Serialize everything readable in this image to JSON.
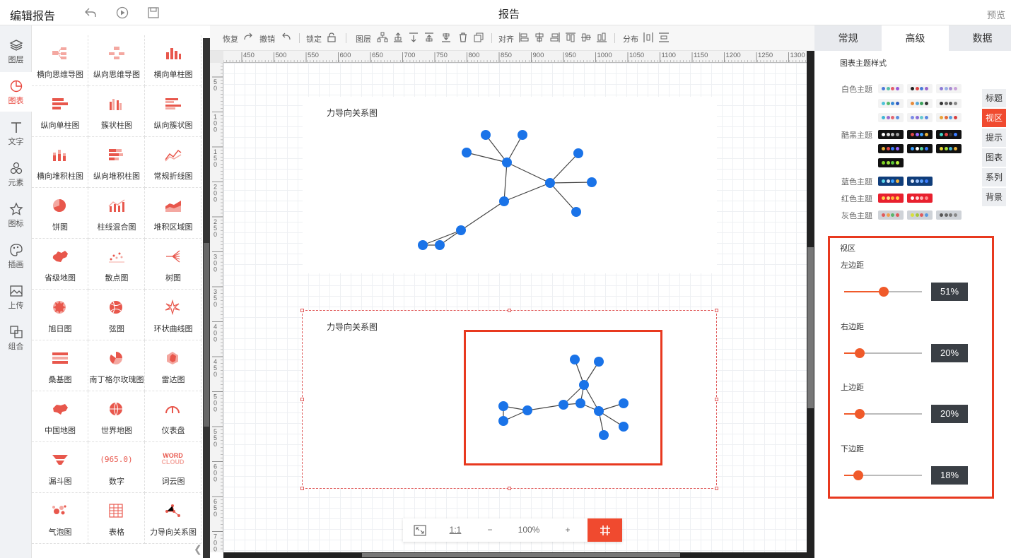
{
  "header": {
    "app_title": "编辑报告",
    "report_title": "报告",
    "preview": "预览"
  },
  "rail": [
    {
      "label": "图层",
      "icon": "layers-icon"
    },
    {
      "label": "图表",
      "icon": "chart-pie-icon",
      "active": true
    },
    {
      "label": "文字",
      "icon": "text-icon"
    },
    {
      "label": "元素",
      "icon": "elements-icon"
    },
    {
      "label": "图标",
      "icon": "star-icon"
    },
    {
      "label": "插画",
      "icon": "palette-icon"
    },
    {
      "label": "上传",
      "icon": "upload-image-icon"
    },
    {
      "label": "组合",
      "icon": "group-icon"
    }
  ],
  "palette": [
    "横向思维导图",
    "纵向思维导图",
    "横向单柱图",
    "纵向单柱图",
    "簇状柱图",
    "纵向簇状图",
    "横向堆积柱图",
    "纵向堆积柱图",
    "常规折线图",
    "饼图",
    "柱线混合图",
    "堆积区域图",
    "省级地图",
    "散点图",
    "树图",
    "旭日图",
    "弦图",
    "环状曲线图",
    "桑基图",
    "南丁格尔玫瑰图",
    "雷达图",
    "中国地图",
    "世界地图",
    "仪表盘",
    "漏斗图",
    "数字",
    "词云图",
    "气泡图",
    "表格",
    "力导向关系图"
  ],
  "palette_icons": {
    "number_text": "(965.0)",
    "wordcloud_line1": "WORD",
    "wordcloud_line2": "CLOUD"
  },
  "toolbar": {
    "redo": "恢复",
    "undo": "撤销",
    "lock": "锁定",
    "layer": "图层",
    "align": "对齐",
    "distribute": "分布"
  },
  "ruler": {
    "top": [
      "450",
      "500",
      "550",
      "600",
      "650",
      "700",
      "750",
      "800",
      "850",
      "900",
      "950",
      "1000",
      "1050",
      "1100",
      "1150",
      "1200",
      "1250",
      "1300"
    ],
    "left": [
      "50",
      "100",
      "150",
      "200",
      "250",
      "300",
      "350",
      "400",
      "450",
      "500",
      "550",
      "600",
      "650",
      "700"
    ]
  },
  "canvas": {
    "chart1": {
      "title": "力导向关系图"
    },
    "chart2": {
      "title": "力导向关系图"
    }
  },
  "zoombar": {
    "actual_size": "1:1",
    "minus": "−",
    "zoom": "100%",
    "plus": "+"
  },
  "right_panel": {
    "tabs": [
      "常规",
      "高级",
      "数据"
    ],
    "active_tab": "高级",
    "theme_heading": "图表主题样式",
    "theme_groups": [
      {
        "label": "白色主题",
        "bg": "#f3f3f3",
        "swatches": [
          [
            "#4e79d9",
            "#56c1a8",
            "#e35d6a",
            "#9a5ad9"
          ],
          [
            "#222",
            "#e04646",
            "#4a7bd8",
            "#9966cc"
          ],
          [
            "#8e7bd6",
            "#9bb0e6",
            "#a78bd1",
            "#c9a2d9"
          ],
          [
            "#4ec3d9",
            "#54b86a",
            "#3a8bd8",
            "#2f5fc2"
          ],
          [
            "#e88b3a",
            "#58a8d8",
            "#3aa05a",
            "#333"
          ],
          [
            "#333",
            "#666",
            "#555",
            "#888"
          ],
          [
            "#3fb6d6",
            "#9a6bd1",
            "#e26672",
            "#5c8fe0"
          ],
          [
            "#7a8ce6",
            "#8a6fd8",
            "#64c8d0",
            "#5a86e0"
          ],
          [
            "#e8a43a",
            "#e36a3a",
            "#55a0e0",
            "#d84040"
          ]
        ]
      },
      {
        "label": "酷黑主题",
        "bg": "#111",
        "swatches": [
          [
            "#fff",
            "#ddd",
            "#bbb",
            "#999"
          ],
          [
            "#e04646",
            "#9966ff",
            "#3aa0ff",
            "#e8b13a"
          ],
          [
            "#3fd6c8",
            "#e04646",
            "#333",
            "#3a7bff"
          ],
          [
            "#e8b13a",
            "#e04646",
            "#3a7bff",
            "#9966ff"
          ],
          [
            "#3aa0ff",
            "#ffffff",
            "#5ad6a0",
            "#3a7bff"
          ],
          [
            "#e8d83a",
            "#a8e63a",
            "#3fb6d6",
            "#e8b13a"
          ],
          [
            "#7ed321",
            "#9be23a",
            "#5ac83a",
            "#b6f23a"
          ]
        ]
      },
      {
        "label": "蓝色主题",
        "bg": "#103d7a",
        "swatches": [
          [
            "#5ad6e8",
            "#e0e8f5",
            "#3aa0ff",
            "#f2b33a"
          ],
          [
            "#e0e8f5",
            "#9fc4ff",
            "#5aa0ff",
            "#3a7bff"
          ]
        ]
      },
      {
        "label": "红色主题",
        "bg": "#e8202e",
        "swatches": [
          [
            "#ffd24a",
            "#ffe08a",
            "#ffb43a",
            "#ffd24a"
          ],
          [
            "#ffffff",
            "#ffd6d6",
            "#ffb0b0",
            "#ff8a8a"
          ]
        ]
      },
      {
        "label": "灰色主题",
        "bg": "#cfd3d8",
        "swatches": [
          [
            "#e05a5a",
            "#f0a050",
            "#5ab56a",
            "#e05a5a"
          ],
          [
            "#d8e03a",
            "#a8c83a",
            "#e05a5a",
            "#5a9ae0"
          ],
          [
            "#555",
            "#666",
            "#777",
            "#888"
          ]
        ]
      }
    ],
    "side_tabs": [
      "标题",
      "视区",
      "提示",
      "图表",
      "系列",
      "背景"
    ],
    "active_side_tab": "视区",
    "viewport": {
      "title": "视区",
      "margins": [
        {
          "label": "左边距",
          "value": "51%",
          "fraction": 0.51
        },
        {
          "label": "右边距",
          "value": "20%",
          "fraction": 0.2
        },
        {
          "label": "上边距",
          "value": "20%",
          "fraction": 0.2
        },
        {
          "label": "下边距",
          "value": "18%",
          "fraction": 0.18
        }
      ]
    }
  },
  "colors": {
    "accent": "#f04a2f",
    "node": "#1a73e8",
    "highlight": "#e8391f"
  }
}
